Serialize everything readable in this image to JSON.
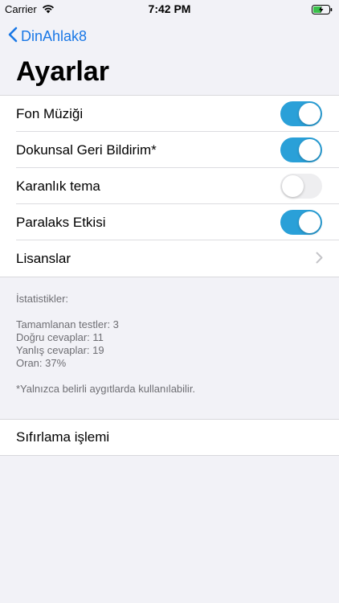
{
  "status_bar": {
    "carrier": "Carrier",
    "time": "7:42 PM",
    "battery_color": "#3ac14a"
  },
  "nav": {
    "back_label": "DinAhlak8",
    "accent_color": "#1a78e6"
  },
  "page": {
    "title": "Ayarlar"
  },
  "settings": {
    "items": [
      {
        "label": "Fon Müziği",
        "type": "toggle",
        "on": true
      },
      {
        "label": "Dokunsal Geri Bildirim*",
        "type": "toggle",
        "on": true
      },
      {
        "label": "Karanlık tema",
        "type": "toggle",
        "on": false
      },
      {
        "label": "Paralaks Etkisi",
        "type": "toggle",
        "on": true
      },
      {
        "label": "Lisanslar",
        "type": "disclosure"
      }
    ],
    "toggle_on_color": "#2aa0d8"
  },
  "stats": {
    "title": "İstatistikler:",
    "completed": "Tamamlanan testler: 3",
    "correct": "Doğru cevaplar: 11",
    "wrong": "Yanlış cevaplar: 19",
    "ratio": "Oran: 37%",
    "note": "*Yalnızca belirli aygıtlarda kullanılabilir."
  },
  "reset": {
    "label": "Sıfırlama işlemi"
  }
}
